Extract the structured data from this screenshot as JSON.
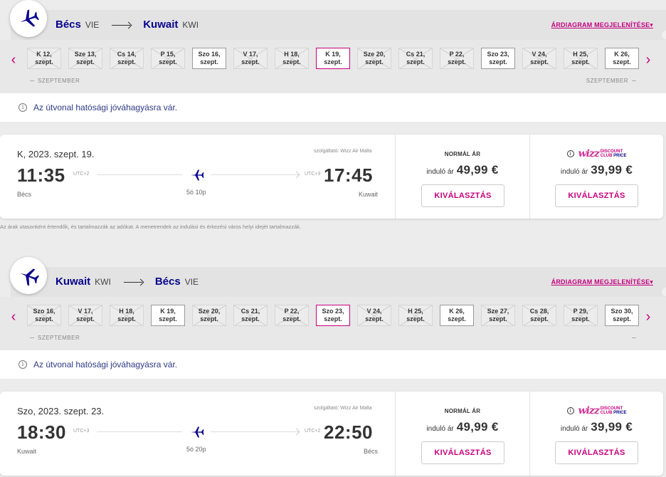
{
  "outbound": {
    "origin_city": "Bécs",
    "origin_code": "VIE",
    "dest_city": "Kuwait",
    "dest_code": "KWI",
    "price_chart_link": "ÁRDIAGRAM MEGJELENÍTÉSE",
    "dates": [
      {
        "label1": "K 12,",
        "label2": "szept.",
        "state": "unavail"
      },
      {
        "label1": "Sze 13,",
        "label2": "szept.",
        "state": "unavail"
      },
      {
        "label1": "Cs 14,",
        "label2": "szept.",
        "state": "unavail"
      },
      {
        "label1": "P 15,",
        "label2": "szept.",
        "state": "unavail"
      },
      {
        "label1": "Szo 16,",
        "label2": "szept.",
        "state": "avail"
      },
      {
        "label1": "V 17,",
        "label2": "szept.",
        "state": "unavail"
      },
      {
        "label1": "H 18,",
        "label2": "szept.",
        "state": "unavail"
      },
      {
        "label1": "K 19,",
        "label2": "szept.",
        "state": "selected"
      },
      {
        "label1": "Sze 20,",
        "label2": "szept.",
        "state": "unavail"
      },
      {
        "label1": "Cs 21,",
        "label2": "szept.",
        "state": "unavail"
      },
      {
        "label1": "P 22,",
        "label2": "szept.",
        "state": "unavail"
      },
      {
        "label1": "Szo 23,",
        "label2": "szept.",
        "state": "avail"
      },
      {
        "label1": "V 24,",
        "label2": "szept.",
        "state": "unavail"
      },
      {
        "label1": "H 25,",
        "label2": "szept.",
        "state": "unavail"
      },
      {
        "label1": "K 26,",
        "label2": "szept.",
        "state": "avail"
      }
    ],
    "month_left": "SZEPTEMBER",
    "month_right": "SZEPTEMBER",
    "notice": "Az útvonal hatósági jóváhagyásra vár.",
    "card": {
      "date": "K, 2023. szept. 19.",
      "operator": "szolgáltató: Wizz Air Malta",
      "dep_time": "11:35",
      "dep_utc": "UTC+2",
      "dep_city": "Bécs",
      "arr_time": "17:45",
      "arr_utc": "UTC+3",
      "arr_city": "Kuwait",
      "duration": "5ó 10p",
      "normal_label": "NORMÁL ÁR",
      "from_label": "induló ár",
      "normal_price": "49,99 €",
      "wdc_price": "39,99 €",
      "select_label": "KIVÁLASZTÁS"
    }
  },
  "inbound": {
    "origin_city": "Kuwait",
    "origin_code": "KWI",
    "dest_city": "Bécs",
    "dest_code": "VIE",
    "price_chart_link": "ÁRDIAGRAM MEGJELENÍTÉSE",
    "dates": [
      {
        "label1": "Szo 16,",
        "label2": "szept.",
        "state": "unavail"
      },
      {
        "label1": "V 17,",
        "label2": "szept.",
        "state": "unavail"
      },
      {
        "label1": "H 18,",
        "label2": "szept.",
        "state": "unavail"
      },
      {
        "label1": "K 19,",
        "label2": "szept.",
        "state": "avail"
      },
      {
        "label1": "Sze 20,",
        "label2": "szept.",
        "state": "unavail"
      },
      {
        "label1": "Cs 21,",
        "label2": "szept.",
        "state": "unavail"
      },
      {
        "label1": "P 22,",
        "label2": "szept.",
        "state": "unavail"
      },
      {
        "label1": "Szo 23,",
        "label2": "szept.",
        "state": "selected"
      },
      {
        "label1": "V 24,",
        "label2": "szept.",
        "state": "unavail"
      },
      {
        "label1": "H 25,",
        "label2": "szept.",
        "state": "unavail"
      },
      {
        "label1": "K 26,",
        "label2": "szept.",
        "state": "avail"
      },
      {
        "label1": "Sze 27,",
        "label2": "szept.",
        "state": "unavail"
      },
      {
        "label1": "Cs 28,",
        "label2": "szept.",
        "state": "unavail"
      },
      {
        "label1": "P 29,",
        "label2": "szept.",
        "state": "unavail"
      },
      {
        "label1": "Szo 30,",
        "label2": "szept.",
        "state": "avail"
      }
    ],
    "month_left": "SZEPTEMBER",
    "month_right": "",
    "notice": "Az útvonal hatósági jóváhagyásra vár.",
    "card": {
      "date": "Szo, 2023. szept. 23.",
      "operator": "szolgáltató: Wizz Air Malta",
      "dep_time": "18:30",
      "dep_utc": "UTC+3",
      "dep_city": "Kuwait",
      "arr_time": "22:50",
      "arr_utc": "UTC+2",
      "arr_city": "Bécs",
      "duration": "5ó 20p",
      "normal_label": "NORMÁL ÁR",
      "from_label": "induló ár",
      "normal_price": "49,99 €",
      "wdc_price": "39,99 €",
      "select_label": "KIVÁLASZTÁS"
    }
  },
  "wdc": {
    "logo_text": "wizz",
    "line1": "DISCOUNT",
    "line2": "CLUB",
    "line3": "PRICE"
  },
  "disclaimer": "Az árak utasonként értendők, és tartalmazzák az adókat. A menetrendek az indulási és érkezési város helyi idejét tartalmazzák.",
  "colors": {
    "brand_magenta": "#c6007e",
    "brand_navy": "#06038d"
  }
}
